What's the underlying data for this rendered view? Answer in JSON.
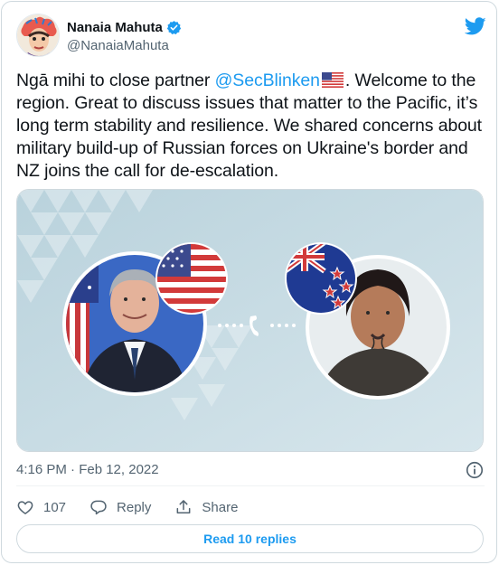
{
  "author": {
    "display_name": "Nanaia Mahuta",
    "handle": "@NanaiaMahuta"
  },
  "tweet": {
    "text_part1": "Ngā mihi to close partner ",
    "mention": "@SecBlinken",
    "text_part2": ". Welcome to the region. Great to discuss issues that matter to the Pacific, it’s long term stability and resilience. We shared concerns about military build-up of Russian forces on Ukraine's border and NZ joins the call for de-escalation."
  },
  "meta": {
    "timestamp": "4:16 PM · Feb 12, 2022"
  },
  "actions": {
    "like_count": "107",
    "reply_label": "Reply",
    "share_label": "Share"
  },
  "read_replies_label": "Read 10 replies",
  "colors": {
    "accent": "#1d9bf0",
    "text_primary": "#0f1419",
    "text_secondary": "#536471",
    "border": "#cfd9de",
    "media_bg": "#c9dde6"
  },
  "icons": [
    "verified-badge-icon",
    "twitter-bird-icon",
    "info-icon",
    "heart-icon",
    "reply-icon",
    "share-icon",
    "us-flag-icon"
  ]
}
